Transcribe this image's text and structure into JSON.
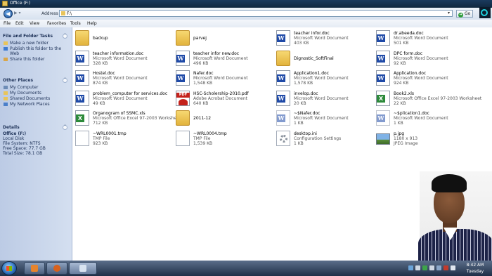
{
  "window": {
    "title": "Office (F:)"
  },
  "address": {
    "label": "Address",
    "path": "F:\\",
    "go_label": "Go"
  },
  "menu": [
    "File",
    "Edit",
    "View",
    "Favorites",
    "Tools",
    "Help"
  ],
  "sidebar": {
    "tasks": {
      "title": "File and Folder Tasks",
      "items": [
        "Make a new folder",
        "Publish this folder to the Web",
        "Share this folder"
      ]
    },
    "places": {
      "title": "Other Places",
      "items": [
        "My Computer",
        "My Documents",
        "Shared Documents",
        "My Network Places"
      ]
    },
    "details": {
      "title": "Details",
      "name": "Office (F:)",
      "lines": [
        "Local Disk",
        "File System: NTFS",
        "Free Space: 77.7 GB",
        "Total Size: 78.1 GB"
      ]
    }
  },
  "files": [
    {
      "name": "backup",
      "type": "",
      "size": "",
      "icon": "folder"
    },
    {
      "name": "parvej",
      "type": "",
      "size": "",
      "icon": "folder"
    },
    {
      "name": "teacher infor.doc",
      "type": "Microsoft Word Document",
      "size": "403 KB",
      "icon": "word"
    },
    {
      "name": "dr.abeeda.doc",
      "type": "Microsoft Word Document",
      "size": "501 KB",
      "icon": "word"
    },
    {
      "name": "teacher information.doc",
      "type": "Microsoft Word Document",
      "size": "328 KB",
      "icon": "word"
    },
    {
      "name": "teacher infor new.doc",
      "type": "Microsoft Word Document",
      "size": "496 KB",
      "icon": "word"
    },
    {
      "name": "Dignostic_SoftFinal",
      "type": "",
      "size": "",
      "icon": "folder"
    },
    {
      "name": "DPC form.doc",
      "type": "Microsoft Word Document",
      "size": "92 KB",
      "icon": "word"
    },
    {
      "name": "Hostel.doc",
      "type": "Microsoft Word Document",
      "size": "874 KB",
      "icon": "word"
    },
    {
      "name": "Nafer.doc",
      "type": "Microsoft Word Document",
      "size": "1,548 KB",
      "icon": "word"
    },
    {
      "name": "Application1.doc",
      "type": "Microsoft Word Document",
      "size": "1,578 KB",
      "icon": "word"
    },
    {
      "name": "Application.doc",
      "type": "Microsoft Word Document",
      "size": "924 KB",
      "icon": "word"
    },
    {
      "name": "problem_computer for services.doc",
      "type": "Microsoft Word Document",
      "size": "49 KB",
      "icon": "word"
    },
    {
      "name": "HSC-Scholership-2010.pdf",
      "type": "Adobe Acrobat Document",
      "size": "640 KB",
      "icon": "pdf"
    },
    {
      "name": "invelop.doc",
      "type": "Microsoft Word Document",
      "size": "20 KB",
      "icon": "word"
    },
    {
      "name": "Book2.xls",
      "type": "Microsoft Office Excel 97-2003 Worksheet",
      "size": "22 KB",
      "icon": "excel"
    },
    {
      "name": "Organogram of SSMC.xls",
      "type": "Microsoft Office Excel 97-2003 Worksheet",
      "size": "712 KB",
      "icon": "excel"
    },
    {
      "name": "2011-12",
      "type": "",
      "size": "",
      "icon": "folder"
    },
    {
      "name": "~$Nafer.doc",
      "type": "Microsoft Word Document",
      "size": "1 KB",
      "icon": "word-ghost"
    },
    {
      "name": "~$plication1.doc",
      "type": "Microsoft Word Document",
      "size": "1 KB",
      "icon": "word-ghost"
    },
    {
      "name": "~WRL0001.tmp",
      "type": "TMP File",
      "size": "923 KB",
      "icon": "file"
    },
    {
      "name": "~WRL0004.tmp",
      "type": "TMP File",
      "size": "1,539 KB",
      "icon": "file"
    },
    {
      "name": "desktop.ini",
      "type": "Configuration Settings",
      "size": "1 KB",
      "icon": "gear"
    },
    {
      "name": "p.jpg",
      "type": "1180 x 913",
      "size": "JPEG Image",
      "icon": "image"
    }
  ],
  "taskbar": {
    "time": "8:42 AM",
    "day": "Tuesday"
  }
}
